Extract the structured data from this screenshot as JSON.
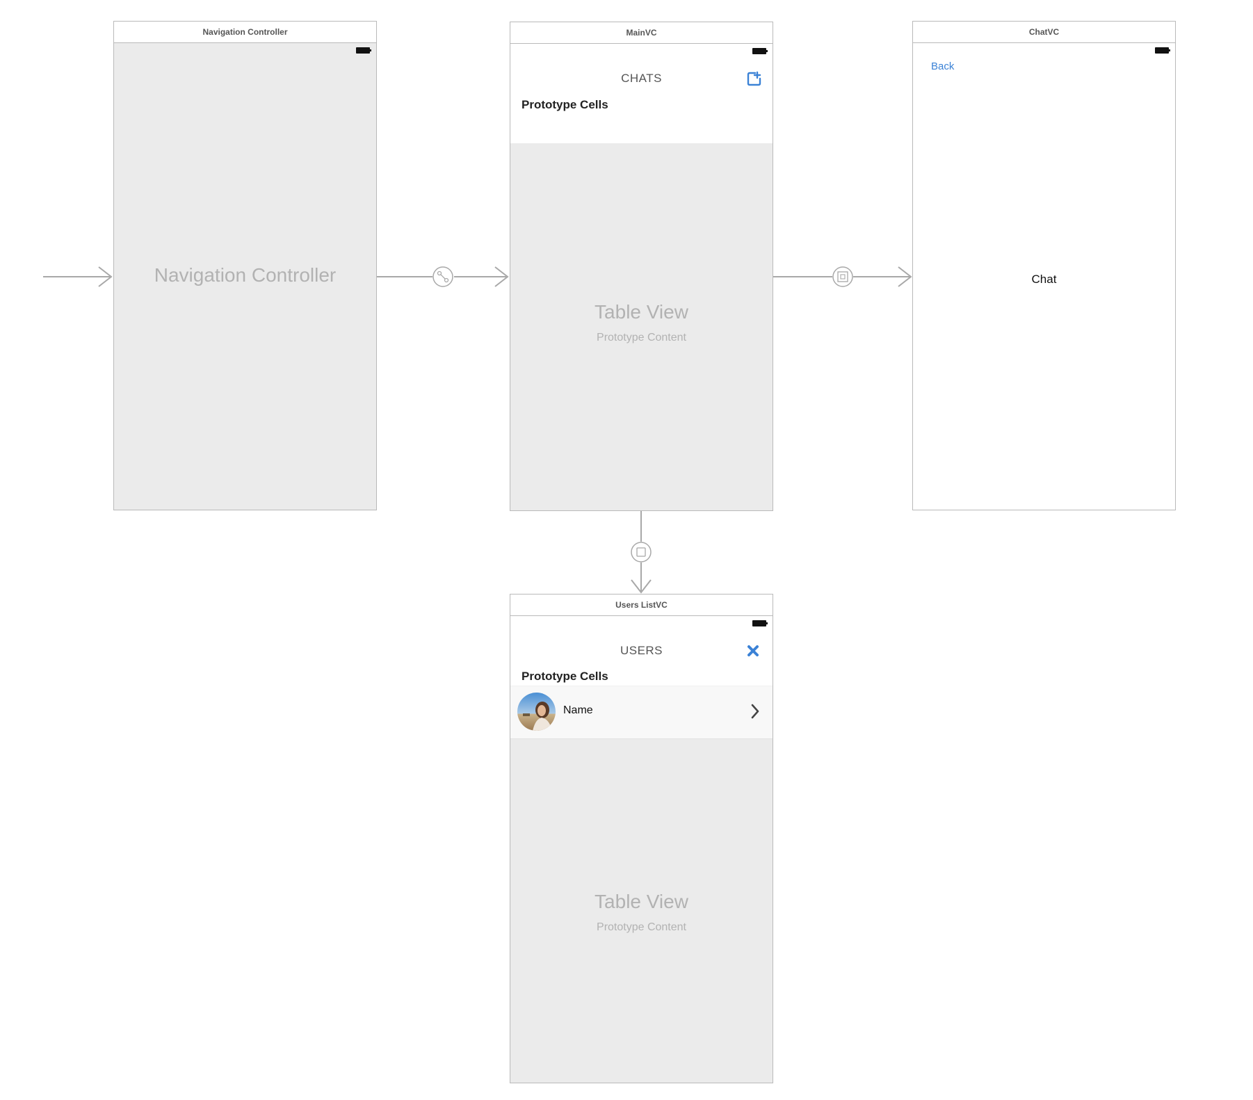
{
  "scenes": {
    "navigation_controller": {
      "title": "Navigation Controller",
      "placeholder": "Navigation Controller"
    },
    "main_vc": {
      "title": "MainVC",
      "nav_title": "CHATS",
      "section_label": "Prototype Cells",
      "table_title": "Table View",
      "table_subtitle": "Prototype Content",
      "add_icon": "compose-icon"
    },
    "chat_vc": {
      "title": "ChatVC",
      "back_label": "Back",
      "center_label": "Chat"
    },
    "users_list_vc": {
      "title": "Users ListVC",
      "nav_title": "USERS",
      "section_label": "Prototype Cells",
      "cell_name": "Name",
      "table_title": "Table View",
      "table_subtitle": "Prototype Content",
      "close_icon": "close-icon"
    }
  },
  "segues": [
    {
      "from": "entry",
      "to": "navigation_controller",
      "kind": "initial-entry-arrow"
    },
    {
      "from": "navigation_controller",
      "to": "main_vc",
      "kind": "relationship-root-icon"
    },
    {
      "from": "main_vc",
      "to": "chat_vc",
      "kind": "show-icon"
    },
    {
      "from": "main_vc",
      "to": "users_list_vc",
      "kind": "present-modally-icon"
    }
  ],
  "colors": {
    "accent_blue": "#3b82d6",
    "placeholder_gray": "#b2b2b2",
    "screen_gray": "#ebebeb",
    "segue_gray": "#a8a8a8"
  }
}
